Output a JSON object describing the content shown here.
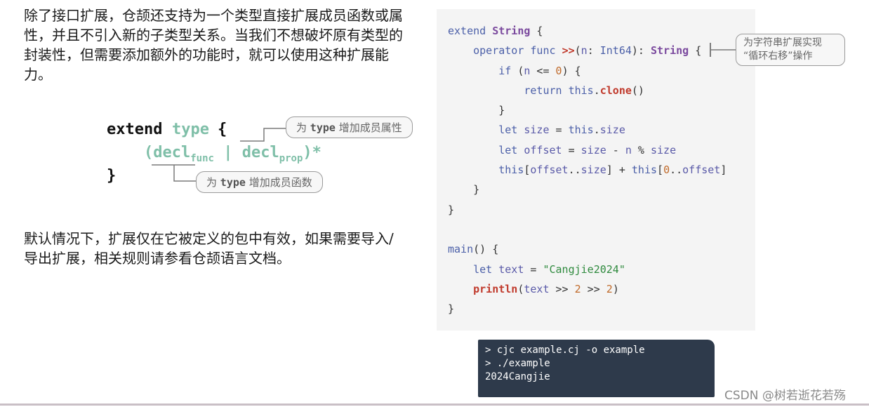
{
  "intro_text": "除了接口扩展，仓颉还支持为一个类型直接扩展成员函数或属性，并且不引入新的子类型关系。当我们不想破坏原有类型的封装性，但需要添加额外的功能时，就可以使用这种扩展能力。",
  "syntax": {
    "kw_extend": "extend",
    "kw_type": "type",
    "brace_open": "{",
    "paren_open": "(",
    "decl": "decl",
    "sub_func": "func",
    "pipe": "|",
    "sub_prop": "prop",
    "paren_close_star": ")*",
    "brace_close": "}",
    "ann_prop": {
      "prefix": "为",
      "word": "type",
      "suffix": "增加成员属性"
    },
    "ann_func": {
      "prefix": "为",
      "word": "type",
      "suffix": "增加成员函数"
    }
  },
  "scope_text": "默认情况下，扩展仅在它被定义的包中有效，如果需要导入/导出扩展，相关规则请参看仓颉语言文档。",
  "code": {
    "l1": {
      "kw": "extend",
      "type": "String",
      "rest": " {"
    },
    "l2": {
      "kw": "operator func",
      "op": ">>",
      "p1": "(",
      "param": "n",
      "p2": ": ",
      "ptype": "Int64",
      "p3": "): ",
      "rtype": "String",
      "p4": " {"
    },
    "l3": {
      "kw": "if",
      "a": " (",
      "var": "n",
      "b": " <= ",
      "num": "0",
      "c": ") {"
    },
    "l4": {
      "kw": "return",
      "sp": " ",
      "this": "this",
      "dot": ".",
      "fn": "clone",
      "end": "()"
    },
    "l5": "}",
    "l6": {
      "kw": "let",
      "sp": " ",
      "var": "size",
      "eq": " = ",
      "this": "this",
      "dot": ".",
      "prop": "size"
    },
    "l7": {
      "kw": "let",
      "sp": " ",
      "var": "offset",
      "eq": " = ",
      "v1": "size",
      "m": " - ",
      "v2": "n",
      "pc": " % ",
      "v3": "size"
    },
    "l8": {
      "this1": "this",
      "b1": "[",
      "v1": "offset",
      "r1": "..",
      "v2": "size",
      "b2": "] + ",
      "this2": "this",
      "b3": "[",
      "num": "0",
      "r2": "..",
      "v3": "offset",
      "b4": "]"
    },
    "l9": "}",
    "l10": "}",
    "l11": {
      "fn": "main",
      "rest": "() {"
    },
    "l12": {
      "kw": "let",
      "sp": " ",
      "var": "text",
      "eq": " = ",
      "str": "\"Cangjie2024\""
    },
    "l13": {
      "fn": "println",
      "a": "(",
      "var": "text",
      "b": " >> ",
      "n1": "2",
      "c": " >> ",
      "n2": "2",
      "d": ")"
    },
    "l14": "}"
  },
  "code_annotation": {
    "line1": "为字符串扩展实现",
    "line2": "“循环右移”操作"
  },
  "terminal": [
    "> cjc example.cj -o example",
    "> ./example",
    "2024Cangjie"
  ],
  "watermark": "CSDN @树若逝花若殇"
}
